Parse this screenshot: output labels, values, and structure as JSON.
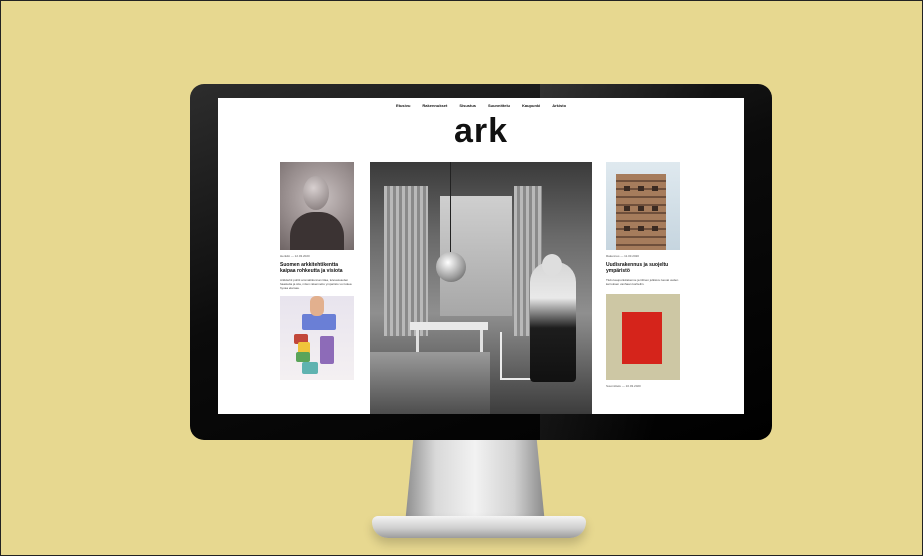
{
  "nav": {
    "items": [
      "Etusivu",
      "Rakennukset",
      "Sisustus",
      "Suunnittelu",
      "Kaupunki",
      "Arkisto"
    ]
  },
  "site": {
    "logo": "ark"
  },
  "left_column": {
    "article1": {
      "meta": "Henkilö — 12.03.2020",
      "headline": "Suomen arkkitehtikentta kaipaa rohkeutta ja visiota",
      "excerpt": "Arkkitehti pohtii ammattikunnan tilaa, tulevaisuuden haasteita ja sita, miten rakennettu ymparisto voi tukea hyvaa elamaa."
    }
  },
  "right_column": {
    "article1": {
      "meta": "Rakennus — 11.03.2020",
      "headline": "Uudisrakennus ja suojeltu ympäristö",
      "excerpt": "Tiivis kaupunkirakenne ja tiilinen julkisivu luovat uuden kerroksen vanhaan kortteliin."
    },
    "article2": {
      "meta": "Suunnittelu — 10.03.2020"
    }
  },
  "colors": {
    "background": "#e7d890",
    "bezel": "#0b0b0b",
    "screen": "#ffffff",
    "poster_red": "#d5241b"
  }
}
